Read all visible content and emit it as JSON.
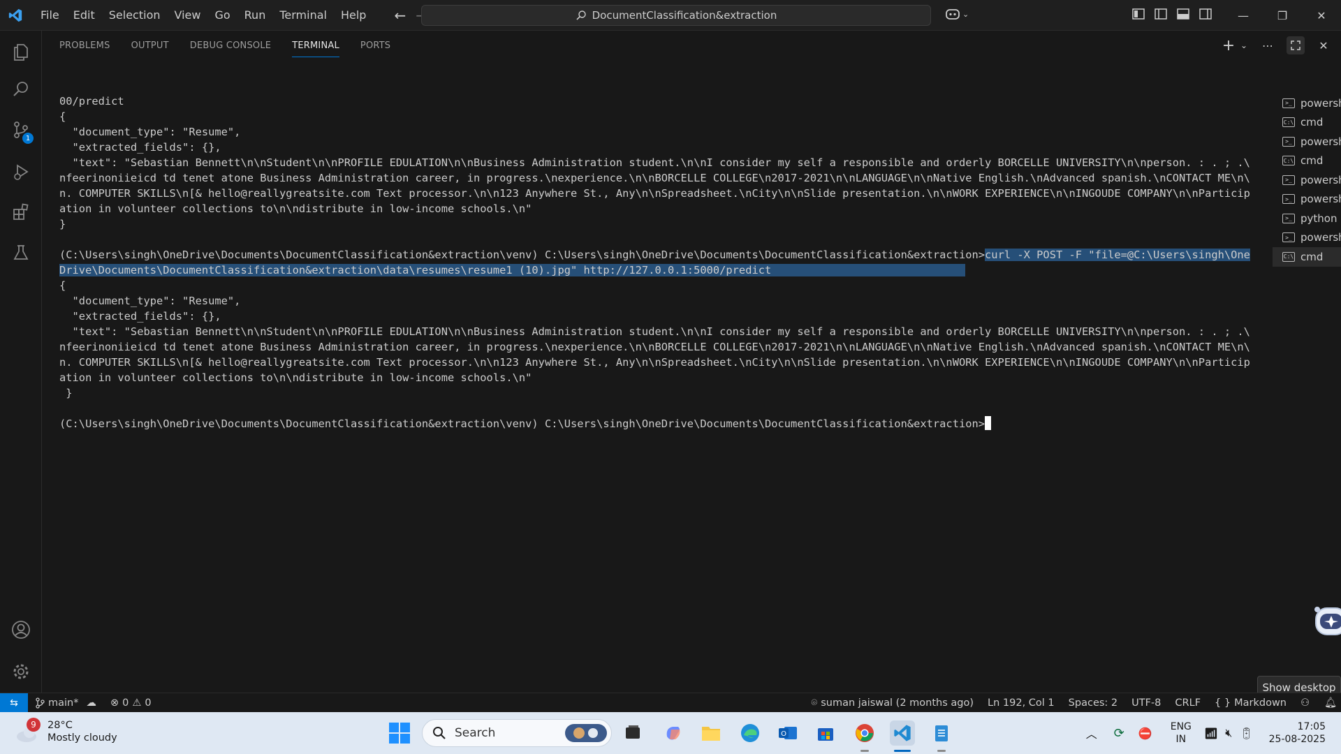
{
  "titlebar": {
    "menu": [
      "File",
      "Edit",
      "Selection",
      "View",
      "Go",
      "Run",
      "Terminal",
      "Help"
    ],
    "command_center": "DocumentClassification&extraction"
  },
  "panel": {
    "tabs": [
      "PROBLEMS",
      "OUTPUT",
      "DEBUG CONSOLE",
      "TERMINAL",
      "PORTS"
    ],
    "active_tab": "TERMINAL"
  },
  "terminal": {
    "lines": [
      {
        "text": "00/predict"
      },
      {
        "text": "{"
      },
      {
        "text": "  \"document_type\": \"Resume\","
      },
      {
        "text": "  \"extracted_fields\": {},"
      },
      {
        "text": "  \"text\": \"Sebastian Bennett\\n\\nStudent\\n\\nPROFILE EDULATION\\n\\nBusiness Administration student.\\n\\nI consider my self a responsible and orderly BORCELLE UNIVERSITY\\n\\nperson. : . ; .\\"
      },
      {
        "text": "nfeerinoniieicd td tenet atone Business Administration career, in progress.\\nexperience.\\n\\nBORCELLE COLLEGE\\n2017-2021\\n\\nLANGUAGE\\n\\nNative English.\\nAdvanced spanish.\\nCONTACT ME\\n\\"
      },
      {
        "text": "n. COMPUTER SKILLS\\n[& hello@reallygreatsite.com Text processor.\\n\\n123 Anywhere St., Any\\n\\nSpreadsheet.\\nCity\\n\\nSlide presentation.\\n\\nWORK EXPERIENCE\\n\\nINGOUDE COMPANY\\n\\nParticip"
      },
      {
        "text": "ation in volunteer collections to\\n\\ndistribute in low-income schools.\\n\""
      },
      {
        "text": "}"
      },
      {
        "text": ""
      },
      {
        "text": "(C:\\Users\\singh\\OneDrive\\Documents\\DocumentClassification&extraction\\venv) C:\\Users\\singh\\OneDrive\\Documents\\DocumentClassification&extraction>",
        "sel": "curl -X POST -F \"file=@C:\\Users\\singh\\One"
      },
      {
        "text": "",
        "sel": "Drive\\Documents\\DocumentClassification&extraction\\data\\resumes\\resume1 (10).jpg\" http://127.0.0.1:5000/predict                              "
      },
      {
        "text": "{"
      },
      {
        "text": "  \"document_type\": \"Resume\","
      },
      {
        "text": "  \"extracted_fields\": {},"
      },
      {
        "text": "  \"text\": \"Sebastian Bennett\\n\\nStudent\\n\\nPROFILE EDULATION\\n\\nBusiness Administration student.\\n\\nI consider my self a responsible and orderly BORCELLE UNIVERSITY\\n\\nperson. : . ; .\\"
      },
      {
        "text": "nfeerinoniieicd td tenet atone Business Administration career, in progress.\\nexperience.\\n\\nBORCELLE COLLEGE\\n2017-2021\\n\\nLANGUAGE\\n\\nNative English.\\nAdvanced spanish.\\nCONTACT ME\\n\\"
      },
      {
        "text": "n. COMPUTER SKILLS\\n[& hello@reallygreatsite.com Text processor.\\n\\n123 Anywhere St., Any\\n\\nSpreadsheet.\\nCity\\n\\nSlide presentation.\\n\\nWORK EXPERIENCE\\n\\nINGOUDE COMPANY\\n\\nParticip"
      },
      {
        "text": "ation in volunteer collections to\\n\\ndistribute in low-income schools.\\n\""
      },
      {
        "text": " }"
      },
      {
        "text": ""
      },
      {
        "text": "(C:\\Users\\singh\\OneDrive\\Documents\\DocumentClassification&extraction\\venv) C:\\Users\\singh\\OneDrive\\Documents\\DocumentClassification&extraction>",
        "cursor": true
      }
    ]
  },
  "terminal_list": [
    {
      "name": "powershell",
      "icon": "powershell-icon"
    },
    {
      "name": "cmd",
      "icon": "cmd-icon"
    },
    {
      "name": "powershell",
      "icon": "powershell-icon"
    },
    {
      "name": "cmd",
      "icon": "cmd-icon"
    },
    {
      "name": "powershell",
      "icon": "powershell-icon"
    },
    {
      "name": "powershell",
      "icon": "powershell-icon"
    },
    {
      "name": "python",
      "icon": "powershell-icon"
    },
    {
      "name": "powershell",
      "icon": "powershell-icon"
    },
    {
      "name": "cmd",
      "icon": "cmd-icon",
      "active": true
    }
  ],
  "tooltip": "Show desktop",
  "statusbar": {
    "branch": "main*",
    "errors": "0",
    "warnings": "0",
    "blame": "suman jaiswal (2 months ago)",
    "position": "Ln 192, Col 1",
    "spaces": "Spaces: 2",
    "encoding": "UTF-8",
    "eol": "CRLF",
    "language": "Markdown"
  },
  "taskbar": {
    "weather_temp": "28°C",
    "weather_desc": "Mostly cloudy",
    "weather_badge": "9",
    "search_label": "Search",
    "lang_line1": "ENG",
    "lang_line2": "IN",
    "time": "17:05",
    "date": "25-08-2025"
  },
  "colors": {
    "accent": "#0078d4",
    "selection": "#264f78",
    "editor_bg": "#181818",
    "taskbar_bg": "#dfe8f3"
  }
}
